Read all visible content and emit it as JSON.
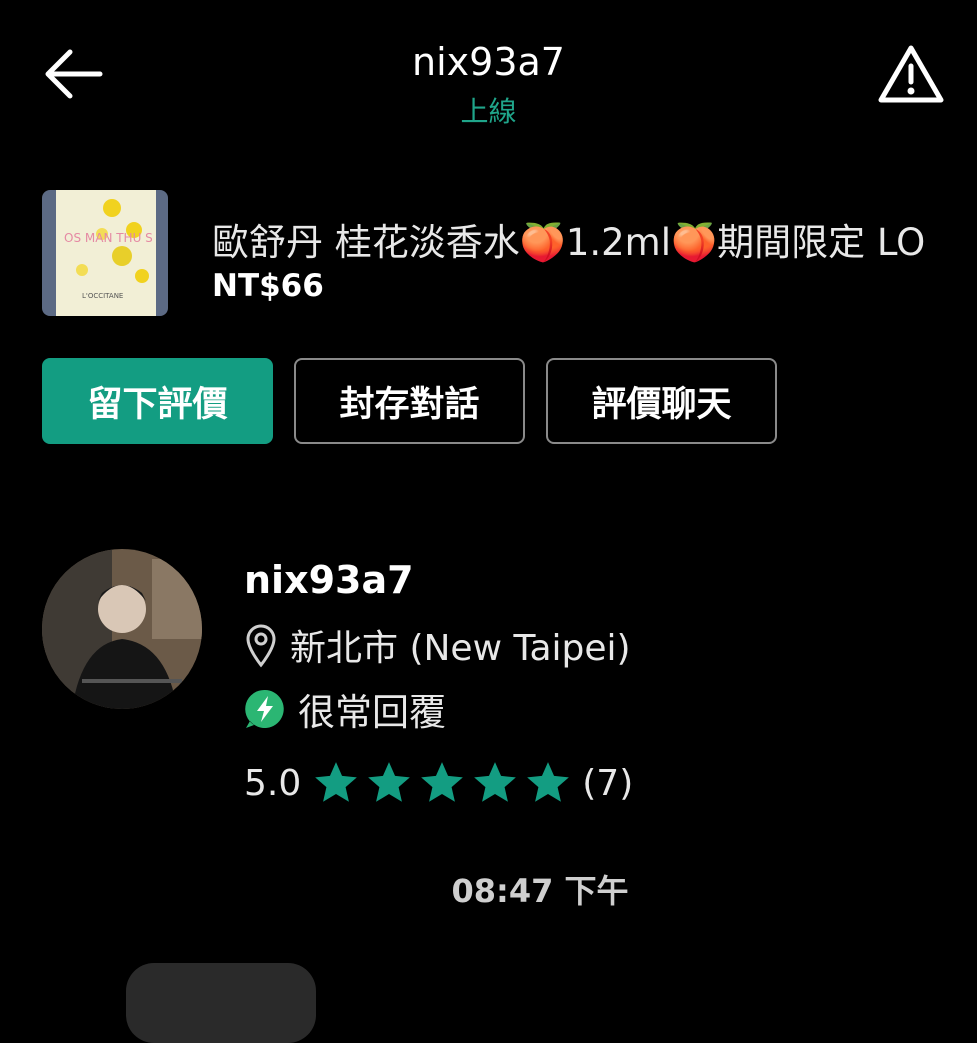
{
  "header": {
    "title": "nix93a7",
    "status": "上線",
    "back_icon": "arrow-left-icon",
    "report_icon": "warning-triangle-icon"
  },
  "listing": {
    "title": "歐舒丹 桂花淡香水🍑1.2ml🍑期間限定 LO",
    "price": "NT$66",
    "thumbnail_text": "OS MAN THU S",
    "thumbnail_brand": "L'OCCITANE"
  },
  "actions": {
    "leave_review": "留下評價",
    "archive_chat": "封存對話",
    "review_chat": "評價聊天"
  },
  "profile": {
    "name": "nix93a7",
    "location": "新北市 (New Taipei)",
    "response": "很常回覆",
    "rating": "5.0",
    "stars": 5,
    "review_count": "(7)"
  },
  "chat": {
    "timestamp": "08:47 下午"
  },
  "colors": {
    "accent": "#139d82",
    "status_green": "#1fa58a",
    "background": "#000000"
  }
}
